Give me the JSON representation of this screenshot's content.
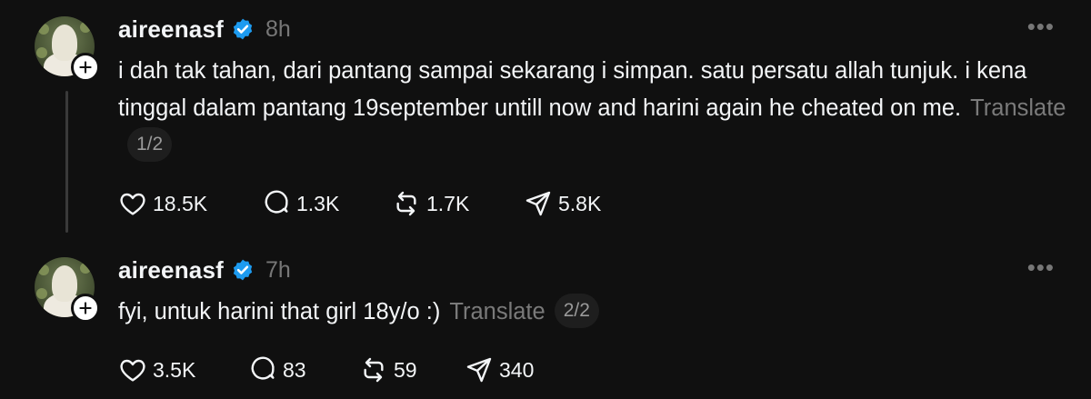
{
  "posts": [
    {
      "username": "aireenasf",
      "time": "8h",
      "more": "•••",
      "text": "i dah tak tahan, dari pantang sampai sekarang i simpan. satu persatu allah tunjuk. i kena tinggal dalam pantang 19september untill now and harini again he cheated on me.",
      "translate": "Translate",
      "page": "1/2",
      "likes": "18.5K",
      "replies": "1.3K",
      "reposts": "1.7K",
      "shares": "5.8K"
    },
    {
      "username": "aireenasf",
      "time": "7h",
      "more": "•••",
      "text": "fyi, untuk harini that girl 18y/o :)",
      "translate": "Translate",
      "page": "2/2",
      "likes": "3.5K",
      "replies": "83",
      "reposts": "59",
      "shares": "340"
    }
  ],
  "icons": {
    "like": "heart-icon",
    "reply": "comment-icon",
    "repost": "repost-icon",
    "share": "send-icon",
    "verified": "verified-badge-icon",
    "follow": "plus-icon"
  },
  "colors": {
    "background": "#101010",
    "text": "#f3f5f7",
    "muted": "#777777",
    "verified": "#1d9bf0"
  }
}
